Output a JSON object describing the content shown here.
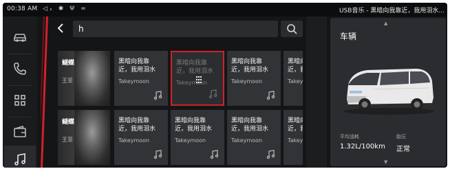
{
  "status_bar": {
    "time": "00:38 AM",
    "icons": [
      "volume-mute-icon",
      "bluetooth-icon",
      "usb-icon",
      "wifi-icon"
    ],
    "now_playing": "USB音乐 - 黑暗向我靠近，我用泪水..."
  },
  "sidebar": {
    "items": [
      {
        "name": "car",
        "icon": "car-icon",
        "active": false
      },
      {
        "name": "phone",
        "icon": "phone-icon",
        "active": false
      },
      {
        "name": "apps",
        "icon": "apps-grid-icon",
        "active": false
      },
      {
        "name": "wallet",
        "icon": "wallet-icon",
        "active": false
      },
      {
        "name": "music",
        "icon": "music-note-icon",
        "active": true
      }
    ]
  },
  "search": {
    "query": "h",
    "back_icon": "chevron-left-icon",
    "search_icon": "search-icon"
  },
  "results": {
    "rows": [
      {
        "artist": {
          "name": "蝴蝶",
          "sub": "王菲"
        },
        "songs": [
          {
            "title": "黑暗向我靠\n近，我用泪水",
            "artist": "Takeymoon",
            "selected": false
          },
          {
            "title": "黑暗向我靠\n近，我用泪水",
            "artist": "Takeymoon",
            "selected": true
          },
          {
            "title": "黑暗向我靠\n近，我用泪水",
            "artist": "Takeymoon",
            "selected": false
          },
          {
            "title": "黑暗向\n近，我",
            "artist": "Takey",
            "selected": false
          }
        ]
      },
      {
        "artist": {
          "name": "蝴蝶",
          "sub": "王菲"
        },
        "songs": [
          {
            "title": "黑暗向我靠\n近，我用泪水",
            "artist": "Takeymoon",
            "selected": false
          },
          {
            "title": "黑暗向我靠\n近，我用泪水",
            "artist": "Takeymoon",
            "selected": false
          },
          {
            "title": "黑暗向我靠\n近，我用泪水",
            "artist": "Takeymoon",
            "selected": false
          },
          {
            "title": "黑暗向\n近，我",
            "artist": "Takey",
            "selected": false
          }
        ]
      }
    ]
  },
  "vehicle_panel": {
    "title": "车辆",
    "stats": [
      {
        "label": "平均油耗",
        "value": "1.32L/100km"
      },
      {
        "label": "胎压",
        "value": "正常"
      }
    ]
  },
  "colors": {
    "accent": "#d4202a",
    "background": "#141517",
    "card": "#323336",
    "panel": "#2b2c2f"
  }
}
